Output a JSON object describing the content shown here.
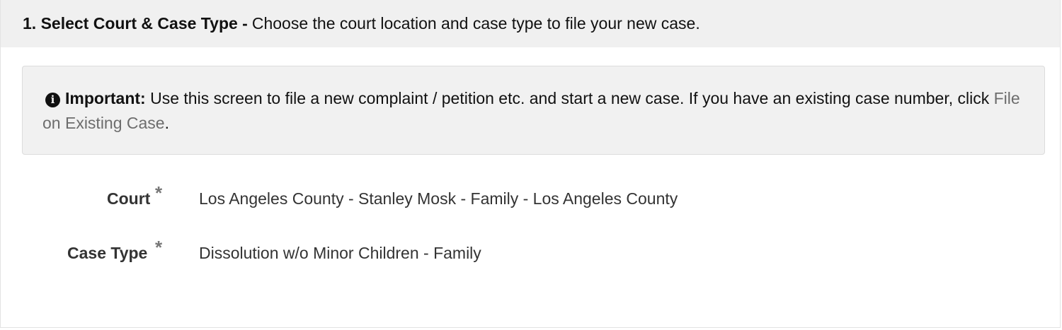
{
  "header": {
    "step_title": "1. Select Court & Case Type -",
    "step_description": "Choose the court location and case type to file your new case."
  },
  "notice": {
    "icon": "info-icon",
    "strong": "Important:",
    "text": "Use this screen to file a new complaint / petition etc. and start a new case. If you have an existing case number, click",
    "link_text": "File on Existing Case",
    "trailing": "."
  },
  "fields": {
    "court": {
      "label": "Court",
      "required_mark": "*",
      "value": "Los Angeles County - Stanley Mosk - Family - Los Angeles County"
    },
    "case_type": {
      "label": "Case Type",
      "required_mark": "*",
      "value": "Dissolution w/o Minor Children - Family"
    }
  }
}
